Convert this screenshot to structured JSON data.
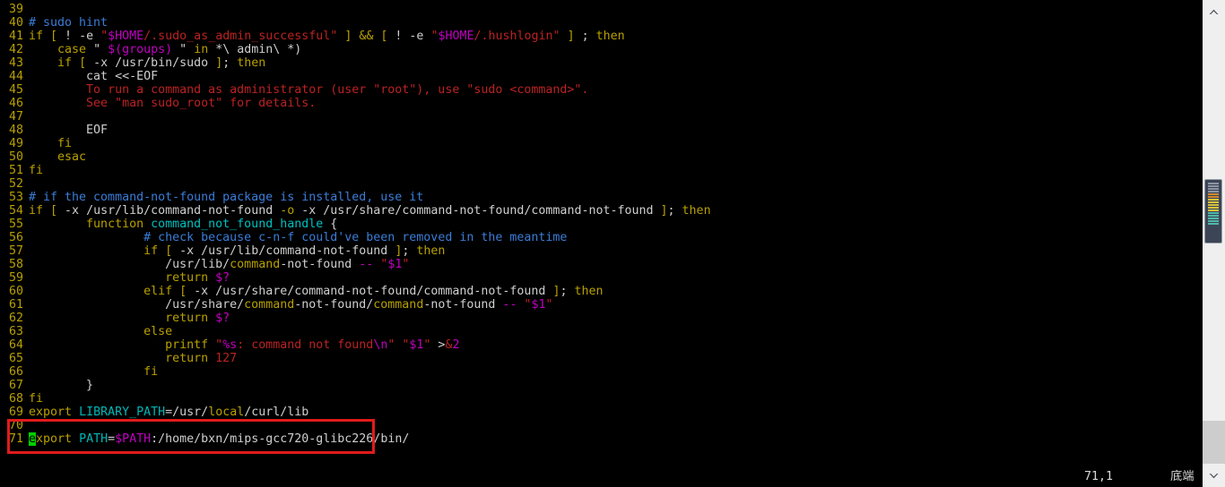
{
  "window": {
    "title": "vim - .bashrc",
    "background": "#000000",
    "accent_red": "#e01b1b",
    "cursor_color": "#00d000"
  },
  "editor": {
    "first_line_number": 39,
    "lines": [
      {
        "n": "39",
        "tokens": []
      },
      {
        "n": "40",
        "tokens": [
          {
            "t": "# sudo hint",
            "c": "c-cmt"
          }
        ]
      },
      {
        "n": "41",
        "tokens": [
          {
            "t": "if",
            "c": "c-stmt"
          },
          {
            "t": " ",
            "c": "c-norm"
          },
          {
            "t": "[",
            "c": "c-stmt"
          },
          {
            "t": " ! -e ",
            "c": "c-norm"
          },
          {
            "t": "\"",
            "c": "c-str"
          },
          {
            "t": "$HOME",
            "c": "c-pre"
          },
          {
            "t": "/.sudo_as_admin_successful\"",
            "c": "c-str"
          },
          {
            "t": " ",
            "c": "c-norm"
          },
          {
            "t": "]",
            "c": "c-stmt"
          },
          {
            "t": " ",
            "c": "c-norm"
          },
          {
            "t": "&&",
            "c": "c-stmt"
          },
          {
            "t": " ",
            "c": "c-norm"
          },
          {
            "t": "[",
            "c": "c-stmt"
          },
          {
            "t": " ! -e ",
            "c": "c-norm"
          },
          {
            "t": "\"",
            "c": "c-str"
          },
          {
            "t": "$HOME",
            "c": "c-pre"
          },
          {
            "t": "/.hushlogin\"",
            "c": "c-str"
          },
          {
            "t": " ",
            "c": "c-norm"
          },
          {
            "t": "]",
            "c": "c-stmt"
          },
          {
            "t": " ; ",
            "c": "c-norm"
          },
          {
            "t": "then",
            "c": "c-stmt"
          }
        ]
      },
      {
        "n": "42",
        "tokens": [
          {
            "t": "    ",
            "c": "c-norm"
          },
          {
            "t": "case",
            "c": "c-stmt"
          },
          {
            "t": " \"",
            "c": "c-norm"
          },
          {
            "t": " ",
            "c": "c-str"
          },
          {
            "t": "$(groups)",
            "c": "c-pre"
          },
          {
            "t": " ",
            "c": "c-str"
          },
          {
            "t": "\" ",
            "c": "c-norm"
          },
          {
            "t": "in",
            "c": "c-stmt"
          },
          {
            "t": " *\\ admin\\ *)",
            "c": "c-norm"
          }
        ]
      },
      {
        "n": "43",
        "tokens": [
          {
            "t": "    ",
            "c": "c-norm"
          },
          {
            "t": "if",
            "c": "c-stmt"
          },
          {
            "t": " ",
            "c": "c-norm"
          },
          {
            "t": "[",
            "c": "c-stmt"
          },
          {
            "t": " -x /usr/bin/sudo ",
            "c": "c-norm"
          },
          {
            "t": "]",
            "c": "c-stmt"
          },
          {
            "t": "; ",
            "c": "c-norm"
          },
          {
            "t": "then",
            "c": "c-stmt"
          }
        ]
      },
      {
        "n": "44",
        "tokens": [
          {
            "t": "        ",
            "c": "c-norm"
          },
          {
            "t": "cat <<-EOF",
            "c": "c-norm"
          }
        ]
      },
      {
        "n": "45",
        "tokens": [
          {
            "t": "        ",
            "c": "c-norm"
          },
          {
            "t": "To run a command as administrator (user \"root\"), use \"sudo <command>\".",
            "c": "c-str"
          }
        ]
      },
      {
        "n": "46",
        "tokens": [
          {
            "t": "        ",
            "c": "c-norm"
          },
          {
            "t": "See \"man sudo_root\" for details.",
            "c": "c-str"
          }
        ]
      },
      {
        "n": "47",
        "tokens": []
      },
      {
        "n": "48",
        "tokens": [
          {
            "t": "        EOF",
            "c": "c-norm"
          }
        ]
      },
      {
        "n": "49",
        "tokens": [
          {
            "t": "    ",
            "c": "c-norm"
          },
          {
            "t": "fi",
            "c": "c-stmt"
          }
        ]
      },
      {
        "n": "50",
        "tokens": [
          {
            "t": "    ",
            "c": "c-norm"
          },
          {
            "t": "esac",
            "c": "c-stmt"
          }
        ]
      },
      {
        "n": "51",
        "tokens": [
          {
            "t": "fi",
            "c": "c-stmt"
          }
        ]
      },
      {
        "n": "52",
        "tokens": []
      },
      {
        "n": "53",
        "tokens": [
          {
            "t": "# if the command-not-found package is installed, use it",
            "c": "c-cmt"
          }
        ]
      },
      {
        "n": "54",
        "tokens": [
          {
            "t": "if",
            "c": "c-stmt"
          },
          {
            "t": " ",
            "c": "c-norm"
          },
          {
            "t": "[",
            "c": "c-stmt"
          },
          {
            "t": " -x /usr/lib/command-not-found ",
            "c": "c-norm"
          },
          {
            "t": "-o",
            "c": "c-stmt"
          },
          {
            "t": " -x /usr/share/command-not-found/command-not-found ",
            "c": "c-norm"
          },
          {
            "t": "]",
            "c": "c-stmt"
          },
          {
            "t": "; ",
            "c": "c-norm"
          },
          {
            "t": "then",
            "c": "c-stmt"
          }
        ]
      },
      {
        "n": "55",
        "tokens": [
          {
            "t": "        ",
            "c": "c-norm"
          },
          {
            "t": "function",
            "c": "c-stmt"
          },
          {
            "t": " ",
            "c": "c-norm"
          },
          {
            "t": "command_not_found_handle",
            "c": "c-func"
          },
          {
            "t": " {",
            "c": "c-norm"
          }
        ]
      },
      {
        "n": "56",
        "tokens": [
          {
            "t": "                ",
            "c": "c-norm"
          },
          {
            "t": "# check because c-n-f could've been removed in the meantime",
            "c": "c-cmt"
          }
        ]
      },
      {
        "n": "57",
        "tokens": [
          {
            "t": "                ",
            "c": "c-norm"
          },
          {
            "t": "if",
            "c": "c-stmt"
          },
          {
            "t": " ",
            "c": "c-norm"
          },
          {
            "t": "[",
            "c": "c-stmt"
          },
          {
            "t": " -x /usr/lib/command-not-found ",
            "c": "c-norm"
          },
          {
            "t": "]",
            "c": "c-stmt"
          },
          {
            "t": "; ",
            "c": "c-norm"
          },
          {
            "t": "then",
            "c": "c-stmt"
          }
        ]
      },
      {
        "n": "58",
        "tokens": [
          {
            "t": "                   ",
            "c": "c-norm"
          },
          {
            "t": "/usr/lib/",
            "c": "c-norm"
          },
          {
            "t": "command",
            "c": "c-stmt"
          },
          {
            "t": "-not-found ",
            "c": "c-norm"
          },
          {
            "t": "--",
            "c": "c-pre"
          },
          {
            "t": " ",
            "c": "c-norm"
          },
          {
            "t": "\"",
            "c": "c-str"
          },
          {
            "t": "$1",
            "c": "c-pre"
          },
          {
            "t": "\"",
            "c": "c-str"
          }
        ]
      },
      {
        "n": "59",
        "tokens": [
          {
            "t": "                   ",
            "c": "c-norm"
          },
          {
            "t": "return",
            "c": "c-stmt"
          },
          {
            "t": " ",
            "c": "c-norm"
          },
          {
            "t": "$?",
            "c": "c-pre"
          }
        ]
      },
      {
        "n": "60",
        "tokens": [
          {
            "t": "                ",
            "c": "c-norm"
          },
          {
            "t": "elif",
            "c": "c-stmt"
          },
          {
            "t": " ",
            "c": "c-norm"
          },
          {
            "t": "[",
            "c": "c-stmt"
          },
          {
            "t": " -x /usr/share/command-not-found/command-not-found ",
            "c": "c-norm"
          },
          {
            "t": "]",
            "c": "c-stmt"
          },
          {
            "t": "; ",
            "c": "c-norm"
          },
          {
            "t": "then",
            "c": "c-stmt"
          }
        ]
      },
      {
        "n": "61",
        "tokens": [
          {
            "t": "                   ",
            "c": "c-norm"
          },
          {
            "t": "/usr/share/",
            "c": "c-norm"
          },
          {
            "t": "command",
            "c": "c-stmt"
          },
          {
            "t": "-not-found/",
            "c": "c-norm"
          },
          {
            "t": "command",
            "c": "c-stmt"
          },
          {
            "t": "-not-found ",
            "c": "c-norm"
          },
          {
            "t": "--",
            "c": "c-pre"
          },
          {
            "t": " ",
            "c": "c-norm"
          },
          {
            "t": "\"",
            "c": "c-str"
          },
          {
            "t": "$1",
            "c": "c-pre"
          },
          {
            "t": "\"",
            "c": "c-str"
          }
        ]
      },
      {
        "n": "62",
        "tokens": [
          {
            "t": "                   ",
            "c": "c-norm"
          },
          {
            "t": "return",
            "c": "c-stmt"
          },
          {
            "t": " ",
            "c": "c-norm"
          },
          {
            "t": "$?",
            "c": "c-pre"
          }
        ]
      },
      {
        "n": "63",
        "tokens": [
          {
            "t": "                ",
            "c": "c-norm"
          },
          {
            "t": "else",
            "c": "c-stmt"
          }
        ]
      },
      {
        "n": "64",
        "tokens": [
          {
            "t": "                   ",
            "c": "c-norm"
          },
          {
            "t": "printf",
            "c": "c-stmt"
          },
          {
            "t": " ",
            "c": "c-norm"
          },
          {
            "t": "\"",
            "c": "c-str"
          },
          {
            "t": "%s",
            "c": "c-pre"
          },
          {
            "t": ": command not found",
            "c": "c-str"
          },
          {
            "t": "\\n",
            "c": "c-pre"
          },
          {
            "t": "\"",
            "c": "c-str"
          },
          {
            "t": " ",
            "c": "c-norm"
          },
          {
            "t": "\"",
            "c": "c-str"
          },
          {
            "t": "$1",
            "c": "c-pre"
          },
          {
            "t": "\"",
            "c": "c-str"
          },
          {
            "t": " >",
            "c": "c-norm"
          },
          {
            "t": "&",
            "c": "c-str"
          },
          {
            "t": "2",
            "c": "c-pre"
          }
        ]
      },
      {
        "n": "65",
        "tokens": [
          {
            "t": "                   ",
            "c": "c-norm"
          },
          {
            "t": "return",
            "c": "c-stmt"
          },
          {
            "t": " ",
            "c": "c-norm"
          },
          {
            "t": "127",
            "c": "c-num"
          }
        ]
      },
      {
        "n": "66",
        "tokens": [
          {
            "t": "                ",
            "c": "c-norm"
          },
          {
            "t": "fi",
            "c": "c-stmt"
          }
        ]
      },
      {
        "n": "67",
        "tokens": [
          {
            "t": "        }",
            "c": "c-norm"
          }
        ]
      },
      {
        "n": "68",
        "tokens": [
          {
            "t": "fi",
            "c": "c-stmt"
          }
        ]
      },
      {
        "n": "69",
        "tokens": [
          {
            "t": "export",
            "c": "c-stmt"
          },
          {
            "t": " ",
            "c": "c-norm"
          },
          {
            "t": "LIBRARY_PATH",
            "c": "c-ident"
          },
          {
            "t": "=/usr/",
            "c": "c-norm"
          },
          {
            "t": "local",
            "c": "c-stmt"
          },
          {
            "t": "/curl/lib",
            "c": "c-norm"
          }
        ]
      },
      {
        "n": "70",
        "tokens": []
      },
      {
        "n": "71",
        "tokens": [
          {
            "t": "e",
            "c": "cursor"
          },
          {
            "t": "xport",
            "c": "c-stmt"
          },
          {
            "t": " ",
            "c": "c-norm"
          },
          {
            "t": "PATH",
            "c": "c-ident"
          },
          {
            "t": "=",
            "c": "c-norm"
          },
          {
            "t": "$PATH",
            "c": "c-pre"
          },
          {
            "t": ":/home/bxn/mips-gcc720-glibc226/bin/",
            "c": "c-norm"
          }
        ]
      }
    ],
    "end_of_buffer_marker": "~"
  },
  "annotation": {
    "shape": "rectangle",
    "color": "#e01b1b",
    "encloses_lines": [
      "70",
      "71"
    ]
  },
  "status": {
    "cursor_position": "71,1",
    "scroll_indicator": "底端"
  },
  "scrollbar": {
    "up_arrow": "chevron-up-icon",
    "down_arrow": "chevron-down-icon",
    "thumb_minimap_colors": [
      "#8d95a3",
      "#8d95a3",
      "#8d95a3",
      "#8d95a3",
      "#d08a2a",
      "#d08a2a",
      "#d6c23a",
      "#d6c23a",
      "#d6c23a",
      "#d6c23a",
      "#d6c23a",
      "#4fb8a8",
      "#4fb8a8",
      "#4fb8a8",
      "#4fb8a8",
      "#4fb8a8"
    ]
  }
}
